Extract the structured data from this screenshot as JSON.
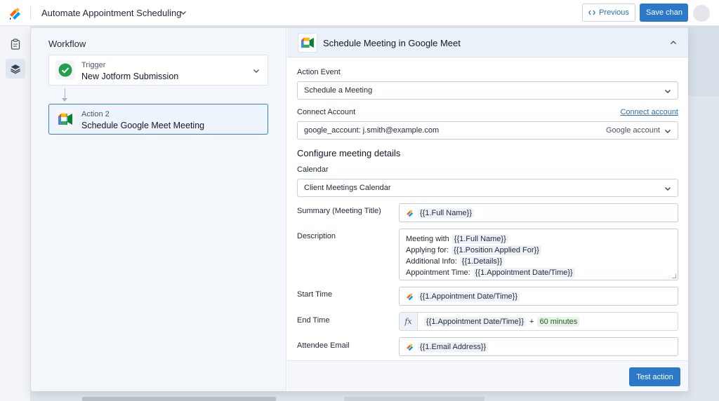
{
  "app": {
    "workflow_title": "Automate Appointment Scheduling",
    "previous_label": "Previous",
    "save_label": "Save chan"
  },
  "left": {
    "heading": "Workflow",
    "steps": [
      {
        "kind": "Trigger",
        "name": "New Jotform Submission",
        "icon": "check-circle-icon"
      },
      {
        "kind": "Action 2",
        "name": "Schedule Google Meet Meeting",
        "icon": "google-meet-icon"
      }
    ]
  },
  "panel": {
    "title": "Schedule Meeting in Google Meet",
    "action_event": {
      "label": "Action Event",
      "value": "Schedule a Meeting"
    },
    "connect_account": {
      "label": "Connect Account",
      "link": "Connect account",
      "value": "google_account: j.smith@example.com",
      "suffix": "Google account"
    },
    "section_title": "Configure meeting details",
    "calendar": {
      "label": "Calendar",
      "value": "Client Meetings Calendar"
    },
    "summary": {
      "label": "Summary (Meeting Title)",
      "token": "{{1.Full Name}}"
    },
    "description": {
      "label": "Description",
      "lines": [
        {
          "text": "Meeting with",
          "token": "{{1.Full Name}}"
        },
        {
          "text": "Applying for:",
          "token": "{{1.Position Applied For}}"
        },
        {
          "text": "Additional Info:",
          "token": "{{1.Details}}"
        },
        {
          "text": "Appointment Time:",
          "token": "{{1.Appointment Date/Time}}"
        }
      ]
    },
    "start_time": {
      "label": "Start Time",
      "token": "{{1.Appointment Date/Time}}"
    },
    "end_time": {
      "label": "End Time",
      "fx": "fx",
      "token": "{{1.Appointment Date/Time}}",
      "operator": "+",
      "offset": "60 minutes"
    },
    "attendee": {
      "label": "Attendee Email",
      "token": "{{1.Email Address}}"
    },
    "test_label": "Test action"
  }
}
